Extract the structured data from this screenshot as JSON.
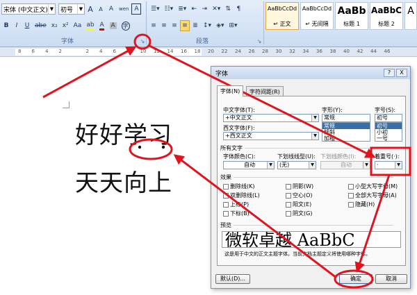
{
  "ribbon": {
    "font_name": "宋体 (中文正文)",
    "font_size": "初号",
    "font_group_label": "字体",
    "paragraph_group_label": "段落",
    "styles": [
      {
        "sample": "AaBbCcDd",
        "name": "↵ 正文"
      },
      {
        "sample": "AaBbCcDd",
        "name": "↵ 无间隔"
      },
      {
        "sample": "AaBb",
        "name": "标题 1"
      },
      {
        "sample": "AaBbC",
        "name": "标题 2"
      },
      {
        "sample": "A",
        "name": ""
      }
    ],
    "format_buttons": {
      "bold": "B",
      "italic": "I",
      "underline": "U",
      "strike": "abe",
      "subscript": "x₂",
      "superscript": "x²",
      "case": "Aa",
      "highlight": "ab",
      "color": "A",
      "charshade": "A",
      "phonetic": "wen",
      "border": "A",
      "grow": "A",
      "shrink": "A",
      "clear": "A",
      "enclose": "字"
    }
  },
  "ruler_ticks": [
    "8",
    "6",
    "4",
    "2",
    "",
    "2",
    "4",
    "6",
    "8",
    "10",
    "12",
    "14",
    "16",
    "18",
    "20",
    "22",
    "24",
    "26",
    "28",
    "30",
    "32",
    "34",
    "36",
    "38",
    "40",
    "42",
    "44",
    "46"
  ],
  "document": {
    "line1": "好好学习",
    "line2": "天天向上"
  },
  "dialog": {
    "title": "字体",
    "help_button": "?",
    "close_button": "X",
    "tabs": [
      "字体(N)",
      "字符间距(R)"
    ],
    "cjk_font_label": "中文字体(T):",
    "cjk_font_value": "+中文正文",
    "western_font_label": "西文字体(F):",
    "western_font_value": "+西文正文",
    "style_label": "字形(Y):",
    "style_value": "常规",
    "style_options": [
      "常规",
      "倾斜",
      "加粗"
    ],
    "size_label": "字号(S):",
    "size_value": "初号",
    "size_options": [
      "初号",
      "小初",
      "一号"
    ],
    "all_text_label": "所有文字",
    "font_color_label": "字体颜色(C):",
    "font_color_value": "自动",
    "underline_type_label": "下划线线型(U):",
    "underline_type_value": "(无)",
    "underline_color_label": "下划线颜色(I):",
    "underline_color_value": "自动",
    "emphasis_label": "着重号(·):",
    "emphasis_value": "·",
    "effects_label": "效果",
    "effects": [
      {
        "label": "删除线(K)",
        "checked": false
      },
      {
        "label": "阴影(W)",
        "checked": false
      },
      {
        "label": "小型大写字母(M)",
        "checked": false
      },
      {
        "label": "双删除线(L)",
        "checked": false
      },
      {
        "label": "空心(O)",
        "checked": false
      },
      {
        "label": "全部大写字母(A)",
        "checked": false
      },
      {
        "label": "上标(P)",
        "checked": false
      },
      {
        "label": "阳文(E)",
        "checked": false
      },
      {
        "label": "隐藏(H)",
        "checked": false
      },
      {
        "label": "下标(B)",
        "checked": false
      },
      {
        "label": "阴文(G)",
        "checked": false
      },
      {
        "label": "",
        "checked": false
      }
    ],
    "preview_label": "预览",
    "preview_sample": "微软卓越 AaBbC",
    "preview_hint": "这是用于中文的正文主题字体。当前文档主题定义将使用哪种字体。",
    "default_button": "默认(D)...",
    "ok_button": "确定",
    "cancel_button": "取消"
  },
  "annotation_color": "#e0141e"
}
